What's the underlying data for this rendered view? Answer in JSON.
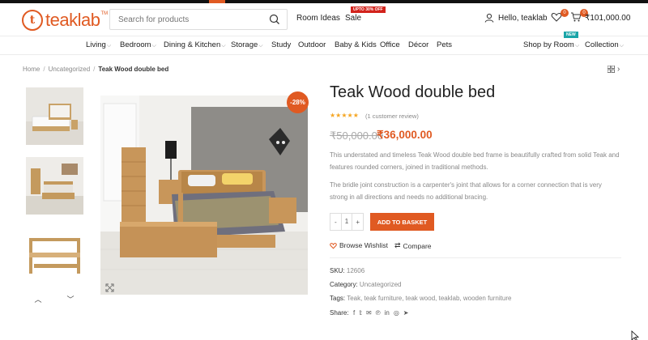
{
  "header": {
    "logo_text": "teaklab",
    "logo_tm": "TM",
    "search_placeholder": "Search for products",
    "room_ideas": "Room Ideas",
    "sale": "Sale",
    "sale_badge": "UPTO 30% OFF",
    "user_greeting": "Hello, teaklab",
    "wishlist_count": "0",
    "cart_count": "0",
    "cart_total": "₹101,000.00"
  },
  "nav": {
    "items": [
      "Living",
      "Bedroom",
      "Dining & Kitchen",
      "Storage",
      "Study",
      "Outdoor",
      "Baby & Kids",
      "Office",
      "Décor",
      "Pets"
    ],
    "shop_by_room": "Shop by Room",
    "new_badge": "NEW",
    "collection": "Collection"
  },
  "breadcrumb": {
    "home": "Home",
    "category": "Uncategorized",
    "current": "Teak Wood double bed"
  },
  "product": {
    "discount": "-28%",
    "title": "Teak Wood double bed",
    "stars": "★★★★★",
    "reviews": "(1 customer review)",
    "old_price": "₹50,000.00",
    "new_price": "₹36,000.00",
    "description_1": "This understated and timeless Teak Wood double bed frame is beautifully crafted from solid Teak and features rounded corners, joined in traditional methods.",
    "description_2": "The bridle joint construction is a carpenter's joint that allows for a corner connection that is very strong in all directions and needs no additional bracing.",
    "qty_minus": "-",
    "qty_value": "1",
    "qty_plus": "+",
    "add_to_basket": "ADD TO BASKET",
    "browse_wishlist": "Browse Wishlist",
    "compare": "Compare",
    "sku_label": "SKU:",
    "sku_value": "12606",
    "category_label": "Category:",
    "category_value": "Uncategorized",
    "tags_label": "Tags:",
    "tags_value": "Teak, teak furniture, teak wood, teaklab, wooden furniture",
    "share_label": "Share:"
  },
  "colors": {
    "accent": "#e05a22",
    "sale_red": "#d2231c",
    "new_teal": "#1aa5a8"
  }
}
